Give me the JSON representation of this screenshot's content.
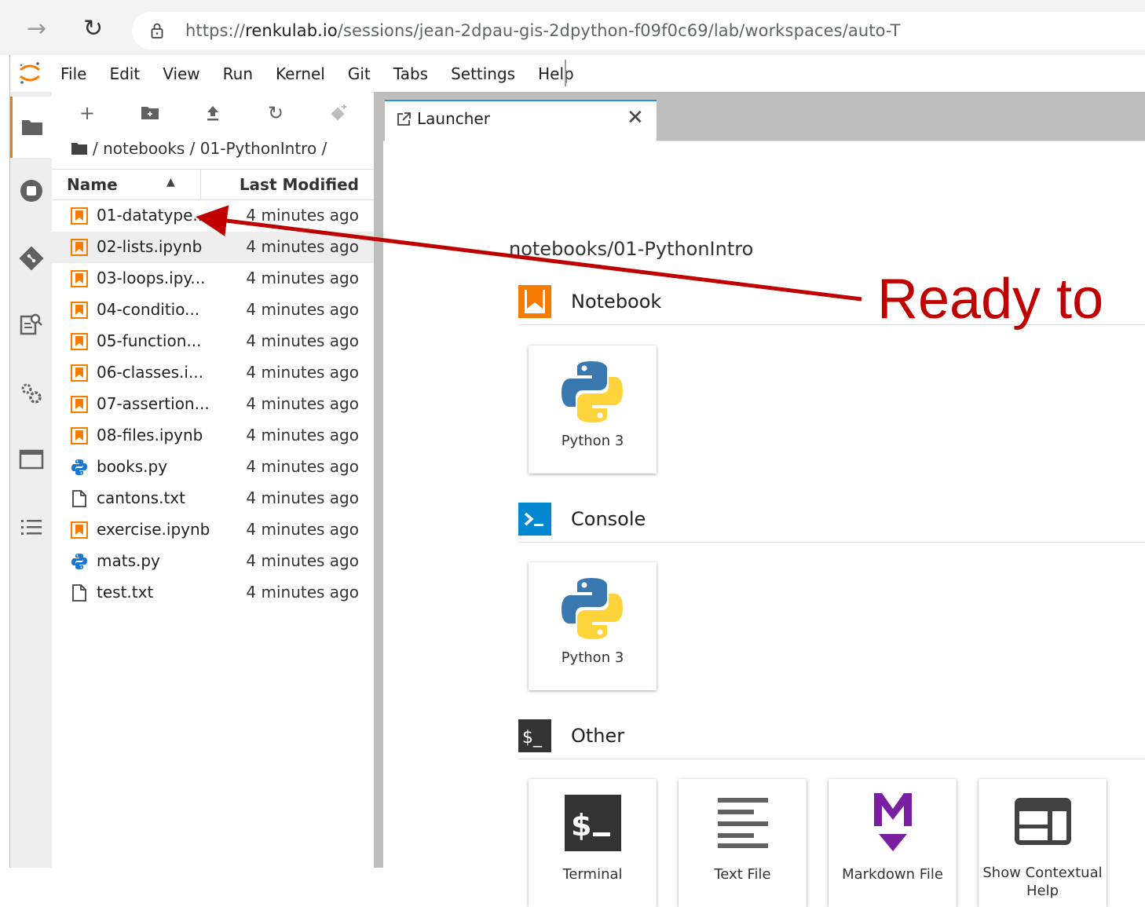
{
  "browser": {
    "url_prefix": "https://",
    "url_host": "renkulab.io",
    "url_path": "/sessions/jean-2dpau-gis-2dpython-f09f0c69/lab/workspaces/auto-T"
  },
  "menubar": {
    "items": [
      "File",
      "Edit",
      "View",
      "Run",
      "Kernel",
      "Git",
      "Tabs",
      "Settings",
      "Help"
    ]
  },
  "filebrowser": {
    "breadcrumb": "/ notebooks / 01-PythonIntro /",
    "col_name": "Name",
    "col_modified": "Last Modified",
    "files": [
      {
        "name": "01-datatype...",
        "modified": "4 minutes ago",
        "type": "notebook"
      },
      {
        "name": "02-lists.ipynb",
        "modified": "4 minutes ago",
        "type": "notebook"
      },
      {
        "name": "03-loops.ipy...",
        "modified": "4 minutes ago",
        "type": "notebook"
      },
      {
        "name": "04-conditio...",
        "modified": "4 minutes ago",
        "type": "notebook"
      },
      {
        "name": "05-function...",
        "modified": "4 minutes ago",
        "type": "notebook"
      },
      {
        "name": "06-classes.i...",
        "modified": "4 minutes ago",
        "type": "notebook"
      },
      {
        "name": "07-assertion...",
        "modified": "4 minutes ago",
        "type": "notebook"
      },
      {
        "name": "08-files.ipynb",
        "modified": "4 minutes ago",
        "type": "notebook"
      },
      {
        "name": "books.py",
        "modified": "4 minutes ago",
        "type": "python"
      },
      {
        "name": "cantons.txt",
        "modified": "4 minutes ago",
        "type": "text"
      },
      {
        "name": "exercise.ipynb",
        "modified": "4 minutes ago",
        "type": "notebook"
      },
      {
        "name": "mats.py",
        "modified": "4 minutes ago",
        "type": "python"
      },
      {
        "name": "test.txt",
        "modified": "4 minutes ago",
        "type": "text"
      }
    ]
  },
  "main": {
    "tab_label": "Launcher",
    "launcher_path": "notebooks/01-PythonIntro",
    "sections": {
      "notebook": {
        "title": "Notebook",
        "cards": [
          "Python 3"
        ]
      },
      "console": {
        "title": "Console",
        "cards": [
          "Python 3"
        ]
      },
      "other": {
        "title": "Other",
        "cards": [
          "Terminal",
          "Text File",
          "Markdown File",
          "Show Contextual Help"
        ]
      }
    }
  },
  "annotation": {
    "text": "Ready to",
    "color": "#c00000"
  },
  "colors": {
    "accent": "#f57c00",
    "console_blue": "#0288d1",
    "tab_active": "#2196f3",
    "markdown_purple": "#7b1fa2"
  }
}
